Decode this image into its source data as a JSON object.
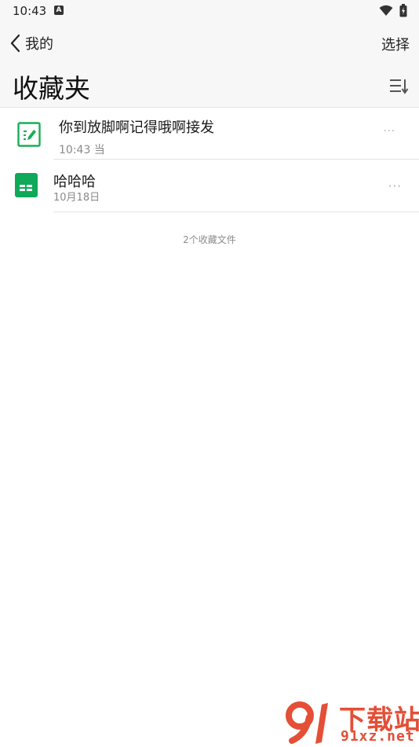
{
  "status_bar": {
    "time": "10:43",
    "notification_icon": "a-icon",
    "wifi_icon": "wifi-icon",
    "battery_icon": "battery-icon"
  },
  "header": {
    "back_label": "我的",
    "select_label": "选择",
    "title": "收藏夹",
    "sort_icon": "sort-icon"
  },
  "files": [
    {
      "title": "你到放脚啊记得哦啊接发",
      "meta": "10:43 当",
      "icon": "note-doc-icon",
      "icon_color": "#1aad57"
    },
    {
      "title": "哈哈哈",
      "meta": "10月18日",
      "icon": "sheet-doc-icon",
      "icon_color": "#0fa958"
    }
  ],
  "more_label": "···",
  "footer": {
    "count_text": "2个收藏文件"
  },
  "watermark": {
    "text": "下载站",
    "url": "91xz.net",
    "color": "#e44f37"
  }
}
